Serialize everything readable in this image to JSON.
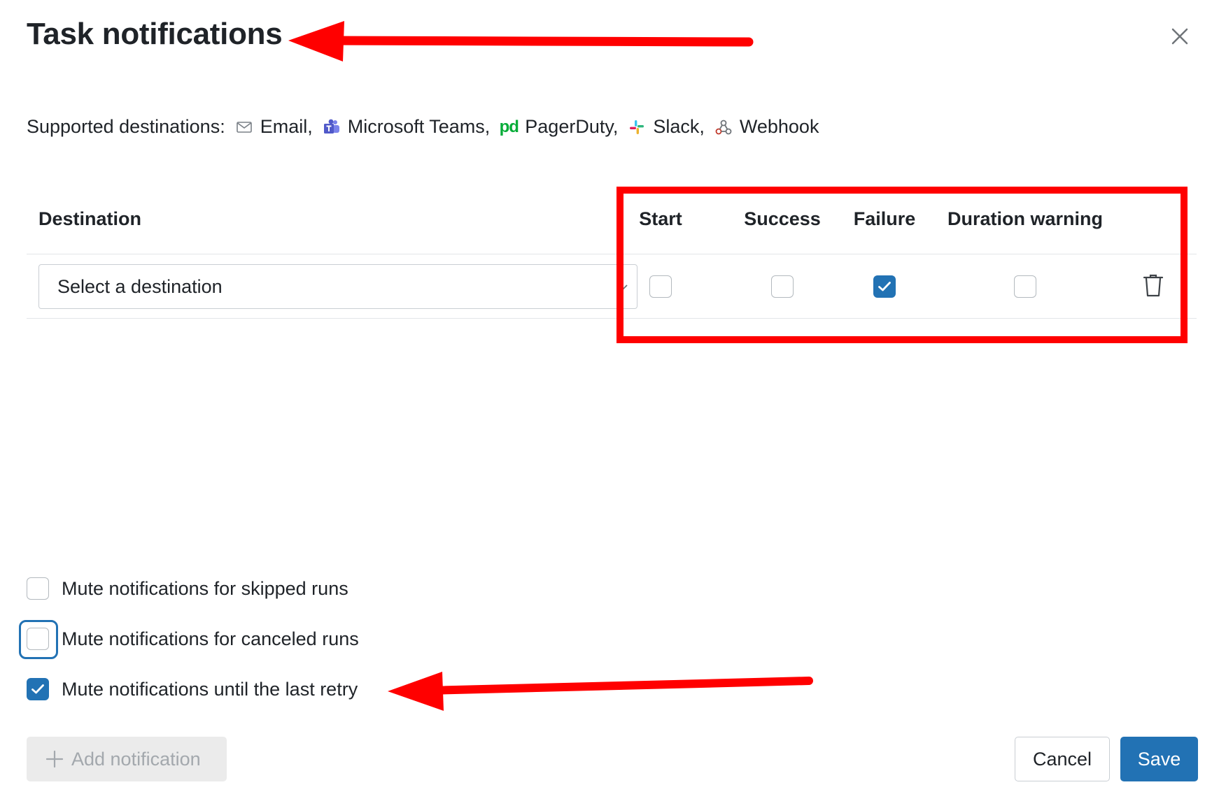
{
  "dialog": {
    "title": "Task notifications"
  },
  "supported": {
    "label": "Supported destinations:",
    "destinations": [
      {
        "label": "Email,",
        "icon": "email-icon"
      },
      {
        "label": "Microsoft Teams,",
        "icon": "microsoft-teams-icon"
      },
      {
        "label": "PagerDuty,",
        "icon": "pagerduty-icon",
        "icon_text": "pd"
      },
      {
        "label": "Slack,",
        "icon": "slack-icon"
      },
      {
        "label": "Webhook",
        "icon": "webhook-icon"
      }
    ]
  },
  "table": {
    "headers": {
      "destination": "Destination",
      "start": "Start",
      "success": "Success",
      "failure": "Failure",
      "duration_warning": "Duration warning"
    },
    "rows": [
      {
        "destination_value": "Select a destination",
        "start": false,
        "success": false,
        "failure": true,
        "duration_warning": false
      }
    ]
  },
  "options": [
    {
      "label": "Mute notifications for skipped runs",
      "checked": false
    },
    {
      "label": "Mute notifications for canceled runs",
      "checked": false,
      "focused": true
    },
    {
      "label": "Mute notifications until the last retry",
      "checked": true
    }
  ],
  "buttons": {
    "add": "Add notification",
    "cancel": "Cancel",
    "save": "Save"
  },
  "colors": {
    "accent": "#2272b4",
    "annotation": "#ff0000",
    "pagerduty": "#06ac38",
    "teams": "#5059c9"
  }
}
